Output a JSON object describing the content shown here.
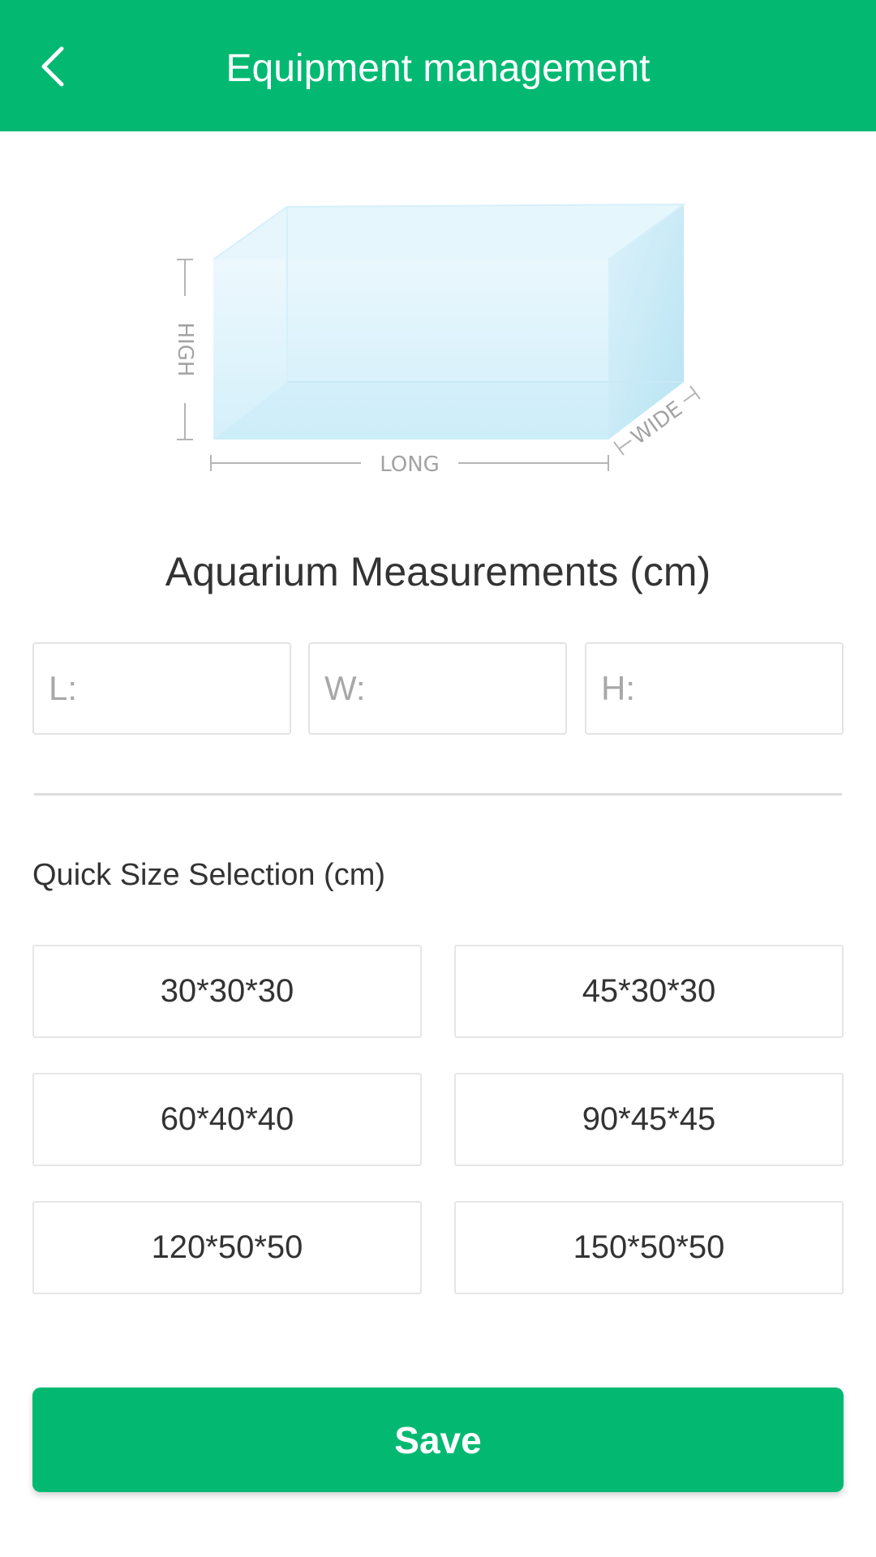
{
  "header": {
    "title": "Equipment management",
    "back_icon": "chevron-left-icon"
  },
  "illustration": {
    "high_label": "HIGH",
    "long_label": "LONG",
    "wide_label": "WIDE"
  },
  "measurements": {
    "title": "Aquarium Measurements (cm)",
    "length_placeholder": "L:",
    "width_placeholder": "W:",
    "height_placeholder": "H:"
  },
  "quick_sizes": {
    "title": "Quick Size Selection (cm)",
    "options": [
      {
        "label": "30*30*30"
      },
      {
        "label": "45*30*30"
      },
      {
        "label": "60*40*40"
      },
      {
        "label": "90*45*45"
      },
      {
        "label": "120*50*50"
      },
      {
        "label": "150*50*50"
      }
    ]
  },
  "save_label": "Save",
  "colors": {
    "accent": "#03b972",
    "tank_glass": "#d4effa",
    "tank_edge": "#b9e2f3"
  }
}
